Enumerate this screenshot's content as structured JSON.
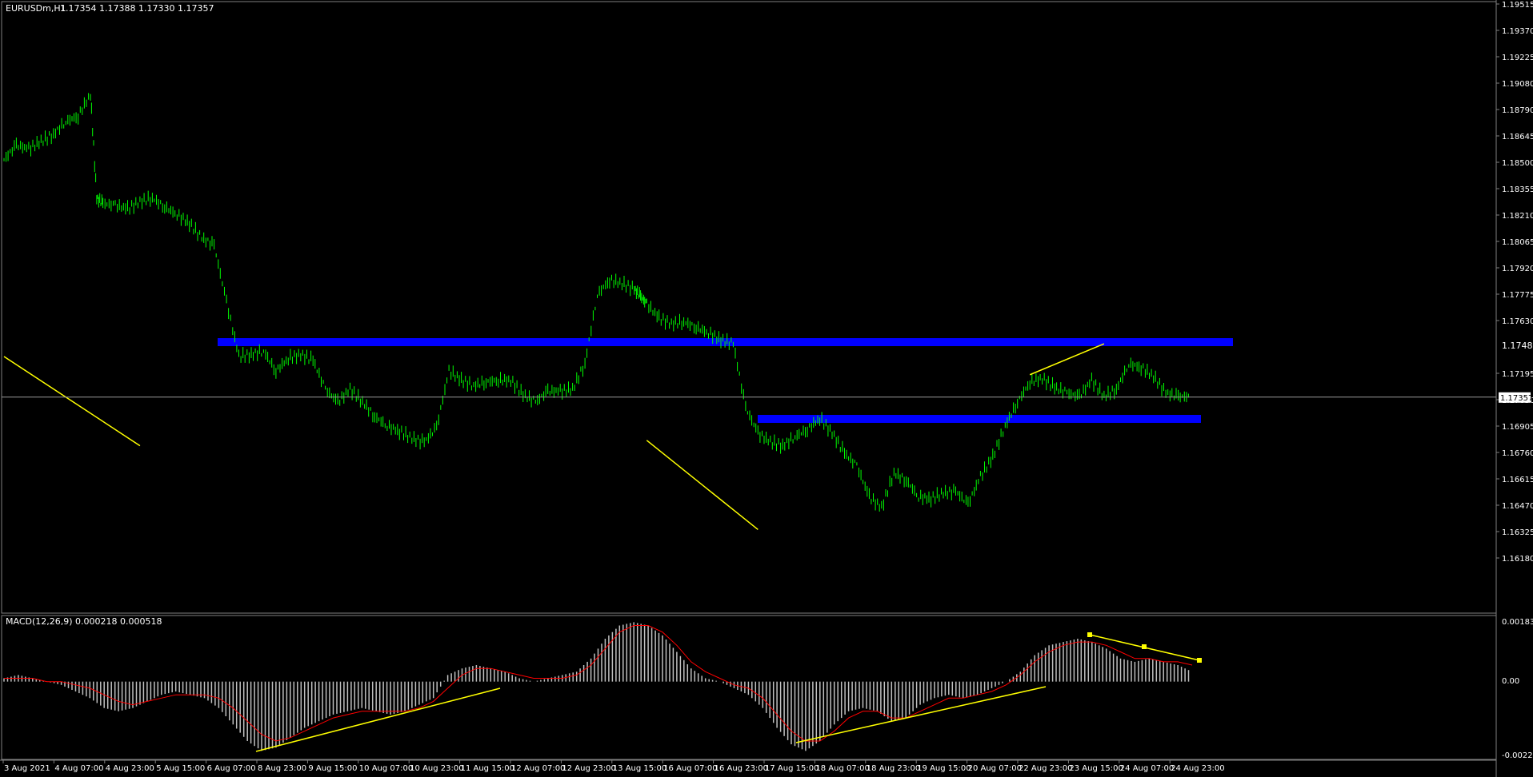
{
  "chart_data": [
    {
      "type": "line",
      "symbol": "EURUSDm,H1",
      "ohlc_label": "1.17354 1.17388 1.17330 1.17357",
      "current_price": 1.17357,
      "current_price_label": "1.17357",
      "ylim": [
        1.1618,
        1.19515
      ],
      "y_ticks": [
        "1.19515",
        "1.19370",
        "1.19225",
        "1.19080",
        "1.18790",
        "1.18645",
        "1.18500",
        "1.18355",
        "1.18210",
        "1.18065",
        "1.17920",
        "1.17775",
        "1.17630",
        "1.17485",
        "1.17195",
        "1.17050",
        "1.16905",
        "1.16760",
        "1.16615",
        "1.16470",
        "1.16325",
        "1.16180"
      ],
      "x_ticks": [
        "3 Aug 2021",
        "4 Aug 07:00",
        "4 Aug 23:00",
        "5 Aug 15:00",
        "6 Aug 07:00",
        "8 Aug 23:00",
        "9 Aug 15:00",
        "10 Aug 07:00",
        "10 Aug 23:00",
        "11 Aug 15:00",
        "12 Aug 07:00",
        "12 Aug 23:00",
        "13 Aug 15:00",
        "16 Aug 07:00",
        "16 Aug 23:00",
        "17 Aug 15:00",
        "18 Aug 07:00",
        "18 Aug 23:00",
        "19 Aug 15:00",
        "20 Aug 07:00",
        "22 Aug 23:00",
        "23 Aug 15:00",
        "24 Aug 07:00",
        "24 Aug 23:00"
      ],
      "series": [
        {
          "x": [
            0,
            4,
            8,
            12,
            16,
            20,
            24,
            28,
            30,
            32,
            36,
            40,
            44,
            48,
            52,
            56,
            60,
            64,
            68,
            72,
            76,
            80,
            84,
            88,
            92,
            96,
            100,
            104,
            108,
            112,
            116,
            120,
            124,
            128,
            132,
            136,
            140,
            144,
            148,
            152,
            156,
            160,
            164,
            168,
            172,
            176,
            180,
            184,
            188,
            192,
            196,
            200,
            204,
            206,
            208,
            212,
            216,
            220,
            224,
            228,
            232,
            236,
            240,
            244,
            248,
            252,
            256,
            260,
            264,
            268,
            272,
            276,
            280,
            284,
            288,
            292,
            296,
            300,
            304,
            308,
            312,
            316,
            320,
            324,
            328,
            332,
            336,
            340,
            344,
            348,
            352,
            356,
            360,
            364,
            368,
            372,
            376,
            380,
            384
          ],
          "values": [
            1.1866,
            1.1874,
            1.1872,
            1.1876,
            1.188,
            1.1887,
            1.189,
            1.1902,
            1.1845,
            1.1842,
            1.1841,
            1.1839,
            1.1843,
            1.1845,
            1.184,
            1.1836,
            1.1831,
            1.1823,
            1.1819,
            1.1788,
            1.1758,
            1.1759,
            1.1761,
            1.175,
            1.1757,
            1.1759,
            1.1756,
            1.174,
            1.1733,
            1.174,
            1.1733,
            1.1725,
            1.172,
            1.1717,
            1.1713,
            1.1711,
            1.1719,
            1.175,
            1.1745,
            1.1742,
            1.1744,
            1.1745,
            1.1745,
            1.1737,
            1.1733,
            1.1739,
            1.1739,
            1.174,
            1.1754,
            1.1792,
            1.18,
            1.1798,
            1.1795,
            1.1791,
            1.1787,
            1.1779,
            1.1776,
            1.1777,
            1.1774,
            1.1771,
            1.1767,
            1.1765,
            1.173,
            1.1716,
            1.1711,
            1.1709,
            1.1714,
            1.1718,
            1.1724,
            1.1716,
            1.1705,
            1.1698,
            1.1681,
            1.1675,
            1.1694,
            1.169,
            1.1681,
            1.168,
            1.1683,
            1.1684,
            1.1677,
            1.1692,
            1.1703,
            1.172,
            1.1733,
            1.1744,
            1.1746,
            1.1741,
            1.1738,
            1.1736,
            1.1745,
            1.1736,
            1.174,
            1.1754,
            1.1752,
            1.1747,
            1.1738,
            1.1736,
            1.1736
          ]
        }
      ],
      "support_resistance_zones": [
        {
          "price": 1.17655,
          "color": "#0000ff"
        },
        {
          "price": 1.1722,
          "color": "#0000ff"
        }
      ],
      "trendlines": [
        {
          "points": [
            [
              0,
              1.1758
            ],
            [
              44,
              1.1709
            ]
          ],
          "color": "#ffff00"
        },
        {
          "points": [
            [
              208,
              1.1712
            ],
            [
              244,
              1.1663
            ]
          ],
          "color": "#ffff00"
        },
        {
          "points": [
            [
              332,
              1.1748
            ],
            [
              356,
              1.1765
            ]
          ],
          "color": "#ffff00"
        }
      ],
      "colors": {
        "bull": "#00ff00",
        "bear": "#00ff00",
        "zone": "#0000ff",
        "trend": "#ffff00",
        "grid": "#808080"
      }
    },
    {
      "type": "bar",
      "indicator": "MACD",
      "label": "MACD(12,26,9) 0.000218 0.000518",
      "ylim": [
        -0.002237,
        0.001833
      ],
      "y_ticks": [
        "0.001833",
        "0.00",
        "-0.002237"
      ],
      "series": [
        {
          "name": "MACD(12,26,9)",
          "values": [
            0.0001,
            0.0002,
            0.0001,
            0.0,
            -0.0001,
            -0.0003,
            -0.0005,
            -0.0008,
            -0.0009,
            -0.0008,
            -0.0006,
            -0.0004,
            -0.0003,
            -0.0004,
            -0.0005,
            -0.0008,
            -0.0013,
            -0.0018,
            -0.0021,
            -0.002,
            -0.0017,
            -0.0014,
            -0.0012,
            -0.001,
            -0.0009,
            -0.0008,
            -0.0009,
            -0.001,
            -0.0009,
            -0.0007,
            -0.0005,
            0.0002,
            0.0004,
            0.0005,
            0.0004,
            0.0003,
            0.0001,
            0.0,
            0.0001,
            0.0002,
            0.0003,
            0.0007,
            0.0013,
            0.0017,
            0.0018,
            0.0017,
            0.0014,
            0.0009,
            0.0004,
            0.0001,
            0.0,
            -0.0002,
            -0.0004,
            -0.0008,
            -0.0014,
            -0.0019,
            -0.0021,
            -0.0018,
            -0.0013,
            -0.0009,
            -0.0008,
            -0.0009,
            -0.0012,
            -0.0011,
            -0.0007,
            -0.0005,
            -0.0004,
            -0.0005,
            -0.0004,
            -0.0002,
            0.0,
            0.0003,
            0.0008,
            0.0011,
            0.0012,
            0.0013,
            0.0012,
            0.001,
            0.0007,
            0.0006,
            0.0007,
            0.0006,
            0.0005,
            0.0003
          ]
        },
        {
          "name": "Signal",
          "values": [
            0.0001,
            0.0001,
            0.0001,
            0.0,
            0.0,
            -0.0001,
            -0.0002,
            -0.0004,
            -0.0006,
            -0.0007,
            -0.0006,
            -0.0005,
            -0.0004,
            -0.0004,
            -0.0004,
            -0.0005,
            -0.0008,
            -0.0012,
            -0.0016,
            -0.0018,
            -0.0017,
            -0.0015,
            -0.0013,
            -0.0011,
            -0.001,
            -0.0009,
            -0.0009,
            -0.0009,
            -0.0009,
            -0.0008,
            -0.0006,
            -0.0002,
            0.0002,
            0.0004,
            0.0004,
            0.0003,
            0.0002,
            0.0001,
            0.0001,
            0.0001,
            0.0002,
            0.0005,
            0.001,
            0.0015,
            0.0017,
            0.0017,
            0.0015,
            0.0011,
            0.0006,
            0.0003,
            0.0001,
            -0.0001,
            -0.0002,
            -0.0005,
            -0.001,
            -0.0015,
            -0.0018,
            -0.0018,
            -0.0015,
            -0.0011,
            -0.0009,
            -0.0009,
            -0.0011,
            -0.0011,
            -0.0009,
            -0.0007,
            -0.0005,
            -0.0005,
            -0.0004,
            -0.0003,
            -0.0001,
            0.0002,
            0.0006,
            0.0009,
            0.0011,
            0.0012,
            0.0012,
            0.0011,
            0.0009,
            0.0007,
            0.0007,
            0.0006,
            0.0006,
            0.0005
          ]
        }
      ],
      "divergence_lines": [
        {
          "color": "#ffff00"
        },
        {
          "color": "#ffff00"
        },
        {
          "color": "#ffff00"
        }
      ]
    }
  ]
}
